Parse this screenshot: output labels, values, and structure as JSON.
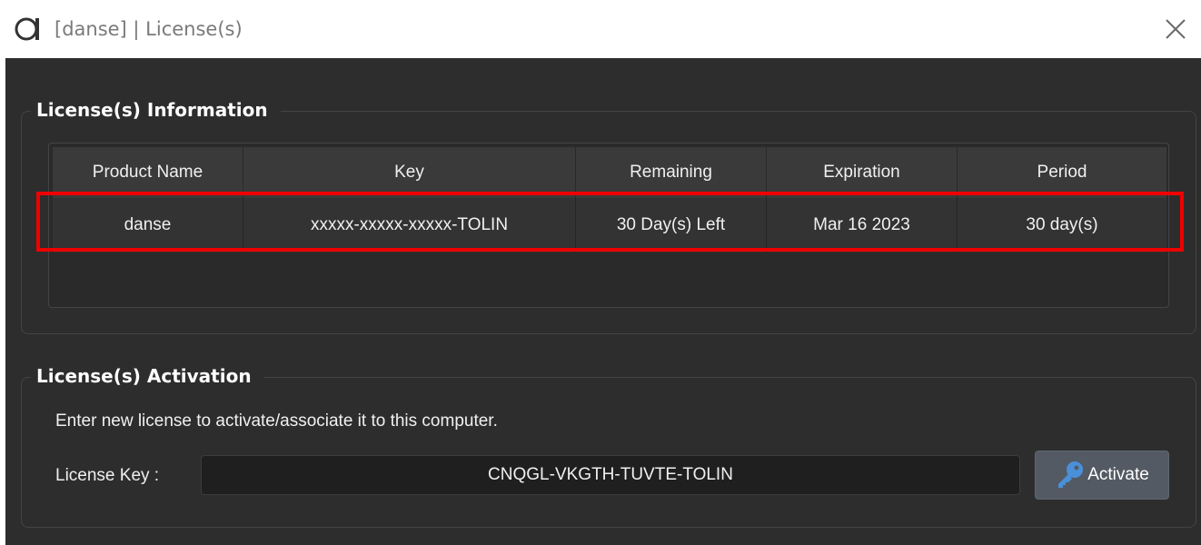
{
  "window": {
    "title": "[danse] | License(s)",
    "app_icon": "app-logo-icon",
    "close_icon": "close-icon"
  },
  "info": {
    "heading": "License(s) Information",
    "columns": [
      "Product Name",
      "Key",
      "Remaining",
      "Expiration",
      "Period"
    ],
    "rows": [
      {
        "product": "danse",
        "key": "xxxxx-xxxxx-xxxxx-TOLIN",
        "remaining": "30 Day(s) Left",
        "expiration": "Mar 16 2023",
        "period": "30 day(s)"
      }
    ],
    "highlight_color": "#ee0000"
  },
  "activation": {
    "heading": "License(s) Activation",
    "instruction": "Enter new license to activate/associate it to this computer.",
    "key_label": "License Key :",
    "key_value": "CNQGL-VKGTH-TUVTE-TOLIN",
    "button_label": "Activate",
    "button_icon": "key-icon"
  },
  "colors": {
    "background": "#2d2d2d",
    "header": "#3a3a3a",
    "accent_icon": "#4a90d9",
    "highlight": "#ee0000"
  }
}
